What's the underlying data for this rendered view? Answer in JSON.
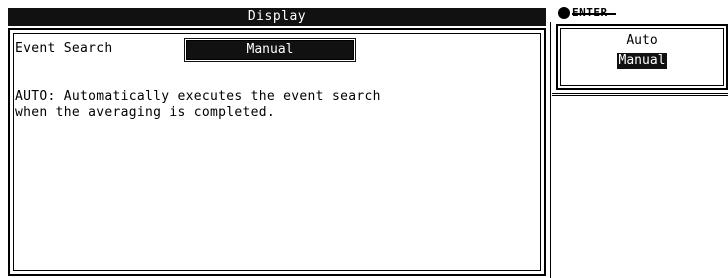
{
  "dialog": {
    "title": "Display",
    "field_label": "Event Search",
    "field_value": "Manual",
    "description": "AUTO: Automatically executes the event search\nwhen the averaging is completed."
  },
  "menu": {
    "header_label": "ENTER",
    "header_icon": "knob-icon",
    "options": [
      {
        "label": "Auto",
        "selected": false
      },
      {
        "label": "Manual",
        "selected": true
      }
    ]
  }
}
